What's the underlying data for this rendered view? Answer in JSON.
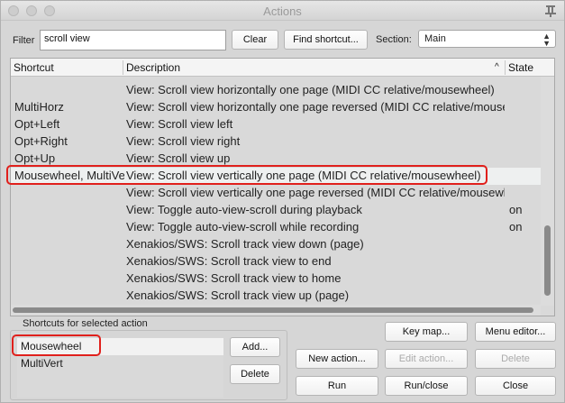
{
  "window": {
    "title": "Actions"
  },
  "filter": {
    "label": "Filter",
    "value": "scroll view"
  },
  "buttons": {
    "clear": "Clear",
    "find_shortcut": "Find shortcut...",
    "add": "Add...",
    "delete_shortcut": "Delete",
    "key_map": "Key map...",
    "menu_editor": "Menu editor...",
    "new_action": "New action...",
    "edit_action": "Edit action...",
    "delete_action": "Delete",
    "run": "Run",
    "run_close": "Run/close",
    "close": "Close"
  },
  "section": {
    "label": "Section:",
    "value": "Main"
  },
  "table": {
    "headers": {
      "shortcut": "Shortcut",
      "description": "Description",
      "state": "State"
    },
    "rows": [
      {
        "shortcut": "",
        "description": "View: Scroll view horizontally one page (MIDI CC relative/mousewheel)",
        "state": ""
      },
      {
        "shortcut": "MultiHorz",
        "description": "View: Scroll view horizontally one page reversed (MIDI CC relative/mousewheel)",
        "state": ""
      },
      {
        "shortcut": "Opt+Left",
        "description": "View: Scroll view left",
        "state": ""
      },
      {
        "shortcut": "Opt+Right",
        "description": "View: Scroll view right",
        "state": ""
      },
      {
        "shortcut": "Opt+Up",
        "description": "View: Scroll view up",
        "state": ""
      },
      {
        "shortcut": "Mousewheel, MultiVert",
        "description": "View: Scroll view vertically one page (MIDI CC relative/mousewheel)",
        "state": "",
        "selected": true
      },
      {
        "shortcut": "",
        "description": "View: Scroll view vertically one page reversed (MIDI CC relative/mousewheel)",
        "state": ""
      },
      {
        "shortcut": "",
        "description": "View: Toggle auto-view-scroll during playback",
        "state": "on"
      },
      {
        "shortcut": "",
        "description": "View: Toggle auto-view-scroll while recording",
        "state": "on"
      },
      {
        "shortcut": "",
        "description": "Xenakios/SWS: Scroll track view down (page)",
        "state": ""
      },
      {
        "shortcut": "",
        "description": "Xenakios/SWS: Scroll track view to end",
        "state": ""
      },
      {
        "shortcut": "",
        "description": "Xenakios/SWS: Scroll track view to home",
        "state": ""
      },
      {
        "shortcut": "",
        "description": "Xenakios/SWS: Scroll track view up (page)",
        "state": ""
      }
    ]
  },
  "shortcuts_panel": {
    "label": "Shortcuts for selected action",
    "items": [
      "Mousewheel",
      "MultiVert"
    ]
  },
  "colors": {
    "highlight": "#e0201c"
  }
}
